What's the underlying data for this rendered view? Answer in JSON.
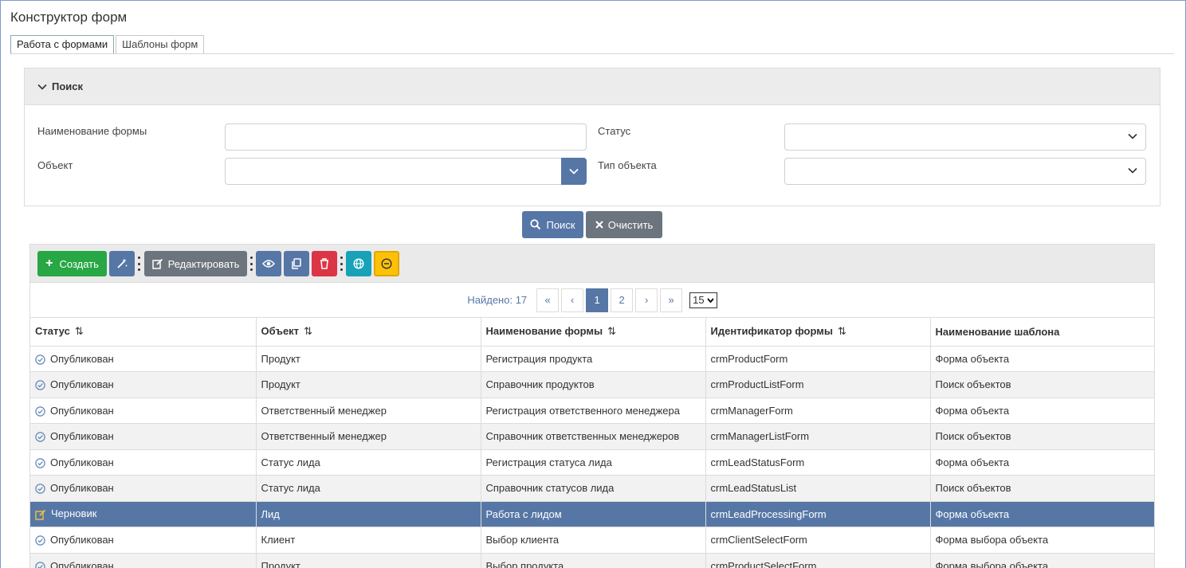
{
  "page": {
    "title": "Конструктор форм"
  },
  "tabs": [
    {
      "label": "Работа с формами",
      "active": true
    },
    {
      "label": "Шаблоны форм",
      "active": false
    }
  ],
  "search": {
    "header": "Поиск",
    "form_name_label": "Наименование формы",
    "form_name_value": "",
    "object_label": "Объект",
    "object_value": "",
    "status_label": "Статус",
    "status_value": "",
    "object_type_label": "Тип объекта",
    "object_type_value": "",
    "search_button": "Поиск",
    "clear_button": "Очистить"
  },
  "toolbar": {
    "create_label": "Создать",
    "edit_label": "Редактировать",
    "colors": {
      "green": "#28a745",
      "blue": "#5677a6",
      "gray": "#6c757d",
      "red": "#dc3545",
      "teal": "#17a2b8",
      "yellow": "#ffc107"
    }
  },
  "pager": {
    "found_text": "Найдено: 17",
    "pages": [
      "1",
      "2"
    ],
    "current_page": "1",
    "first": "«",
    "prev": "‹",
    "next": "›",
    "last": "»",
    "page_size": "15"
  },
  "table": {
    "columns": [
      "Статус",
      "Объект",
      "Наименование формы",
      "Идентификатор формы",
      "Наименование шаблона"
    ],
    "rows": [
      {
        "status": "Опубликован",
        "status_icon": "check-circle-icon",
        "object": "Продукт",
        "name": "Регистрация продукта",
        "id": "crmProductForm",
        "template": "Форма объекта"
      },
      {
        "status": "Опубликован",
        "status_icon": "check-circle-icon",
        "object": "Продукт",
        "name": "Справочник продуктов",
        "id": "crmProductListForm",
        "template": "Поиск объектов"
      },
      {
        "status": "Опубликован",
        "status_icon": "check-circle-icon",
        "object": "Ответственный менеджер",
        "name": "Регистрация ответственного менеджера",
        "id": "crmManagerForm",
        "template": "Форма объекта"
      },
      {
        "status": "Опубликован",
        "status_icon": "check-circle-icon",
        "object": "Ответственный менеджер",
        "name": "Справочник ответственных менеджеров",
        "id": "crmManagerListForm",
        "template": "Поиск объектов"
      },
      {
        "status": "Опубликован",
        "status_icon": "check-circle-icon",
        "object": "Статус лида",
        "name": "Регистрация статуса лида",
        "id": "crmLeadStatusForm",
        "template": "Форма объекта"
      },
      {
        "status": "Опубликован",
        "status_icon": "check-circle-icon",
        "object": "Статус лида",
        "name": "Справочник статусов лида",
        "id": "crmLeadStatusList",
        "template": "Поиск объектов"
      },
      {
        "status": "Черновик",
        "status_icon": "draft-edit-icon",
        "object": "Лид",
        "name": "Работа с лидом",
        "id": "crmLeadProcessingForm",
        "template": "Форма объекта",
        "selected": true
      },
      {
        "status": "Опубликован",
        "status_icon": "check-circle-icon",
        "object": "Клиент",
        "name": "Выбор клиента",
        "id": "crmClientSelectForm",
        "template": "Форма выбора объекта"
      },
      {
        "status": "Опубликован",
        "status_icon": "check-circle-icon",
        "object": "Продукт",
        "name": "Выбор продукта",
        "id": "crmProductSelectForm",
        "template": "Форма выбора объекта"
      }
    ]
  }
}
